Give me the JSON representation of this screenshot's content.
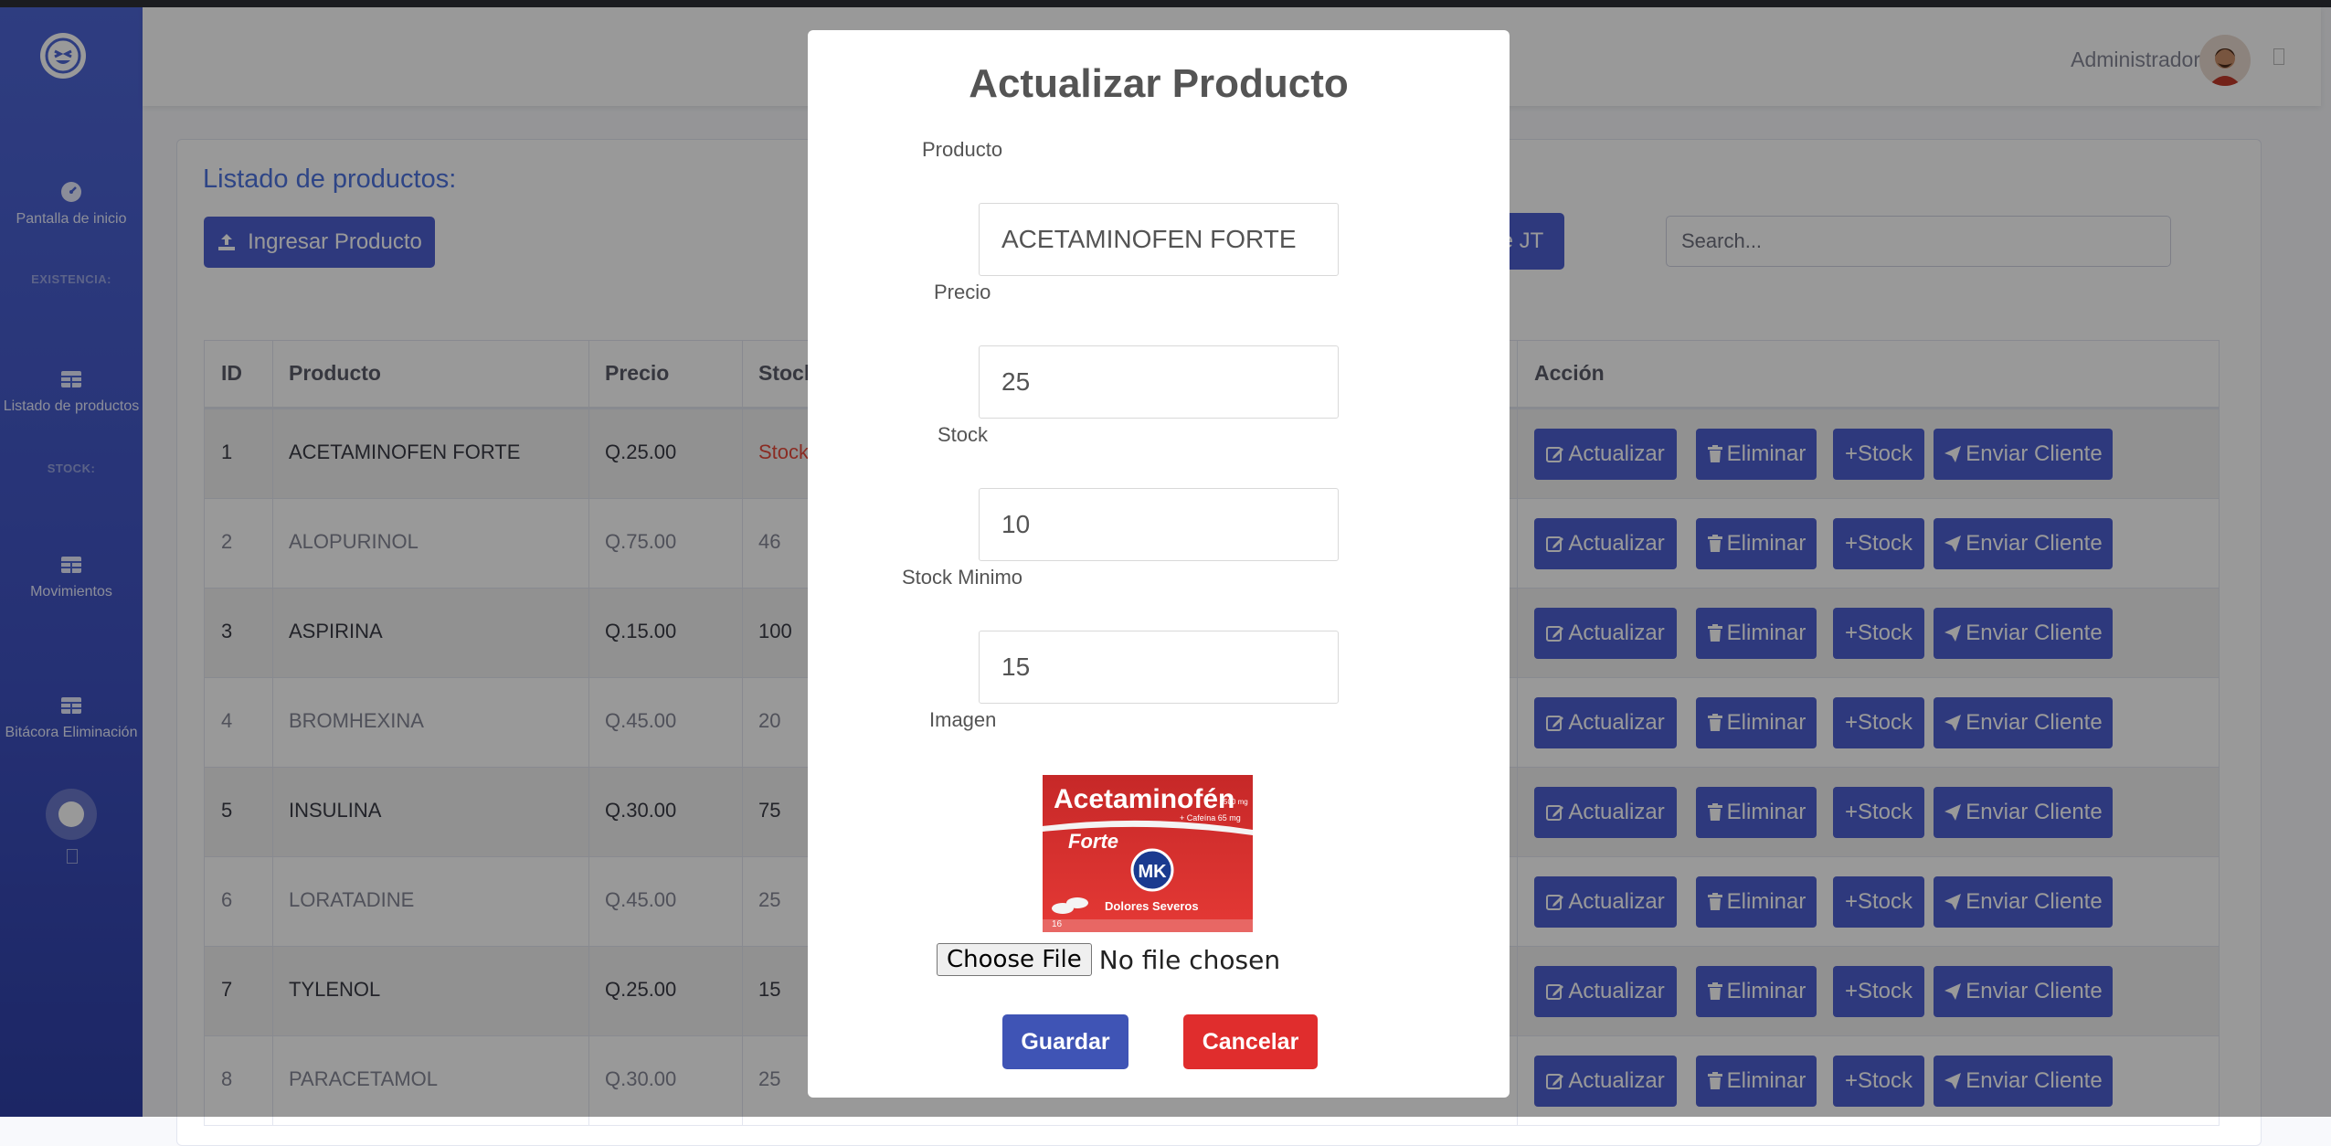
{
  "sidebar": {
    "brand_icon": "laughing-face-icon",
    "items": [
      {
        "label": "Pantalla de inicio",
        "icon": "tachometer-icon"
      },
      {
        "label": "EXISTENCIA:",
        "type": "heading"
      },
      {
        "label": "Listado de productos",
        "icon": "table-icon"
      },
      {
        "label": "STOCK:",
        "type": "heading"
      },
      {
        "label": "Movimientos",
        "icon": "table-icon"
      },
      {
        "label": "Bitácora Eliminación",
        "icon": "table-icon"
      }
    ]
  },
  "topbar": {
    "user_name": "Administrador"
  },
  "main": {
    "title": "Listado de productos:",
    "ingresar_label": "Ingresar Producto",
    "partial_button_label": "e JT",
    "search_placeholder": "Search..."
  },
  "table": {
    "columns": [
      "ID",
      "Producto",
      "Precio",
      "Stock",
      "Acción"
    ],
    "rows": [
      {
        "id": "1",
        "producto": "ACETAMINOFEN FORTE",
        "precio": "Q.25.00",
        "stock": "Stock"
      },
      {
        "id": "2",
        "producto": "ALOPURINOL",
        "precio": "Q.75.00",
        "stock": "46"
      },
      {
        "id": "3",
        "producto": "ASPIRINA",
        "precio": "Q.15.00",
        "stock": "100"
      },
      {
        "id": "4",
        "producto": "BROMHEXINA",
        "precio": "Q.45.00",
        "stock": "20"
      },
      {
        "id": "5",
        "producto": "INSULINA",
        "precio": "Q.30.00",
        "stock": "75"
      },
      {
        "id": "6",
        "producto": "LORATADINE",
        "precio": "Q.45.00",
        "stock": "25"
      },
      {
        "id": "7",
        "producto": "TYLENOL",
        "precio": "Q.25.00",
        "stock": "15"
      },
      {
        "id": "8",
        "producto": "PARACETAMOL",
        "precio": "Q.30.00",
        "stock": "25"
      }
    ],
    "action_labels": {
      "actualizar": "Actualizar",
      "eliminar": "Eliminar",
      "stock": "+Stock",
      "enviar": "Enviar Cliente"
    }
  },
  "modal": {
    "title": "Actualizar Producto",
    "fields": [
      {
        "label": "Producto",
        "value": "ACETAMINOFEN FORTE"
      },
      {
        "label": "Precio",
        "value": "25"
      },
      {
        "label": "Stock",
        "value": "10"
      },
      {
        "label": "Stock Minimo",
        "value": "15"
      }
    ],
    "image_label": "Imagen",
    "image_text": {
      "brand": "Acetaminofén",
      "sub": "Forte",
      "logo": "MK",
      "tagline": "Dolores Severos",
      "dose1": "500 mg",
      "dose2": "+ Cafeína 65 mg",
      "count": "16"
    },
    "file_button": "Choose File",
    "file_status": "No file chosen",
    "guardar": "Guardar",
    "cancelar": "Cancelar"
  },
  "colors": {
    "sidebar": "#4e66d6",
    "primary": "#4e5fd0",
    "cancel": "#e02d2d",
    "modal_primary": "#3f54b5"
  }
}
